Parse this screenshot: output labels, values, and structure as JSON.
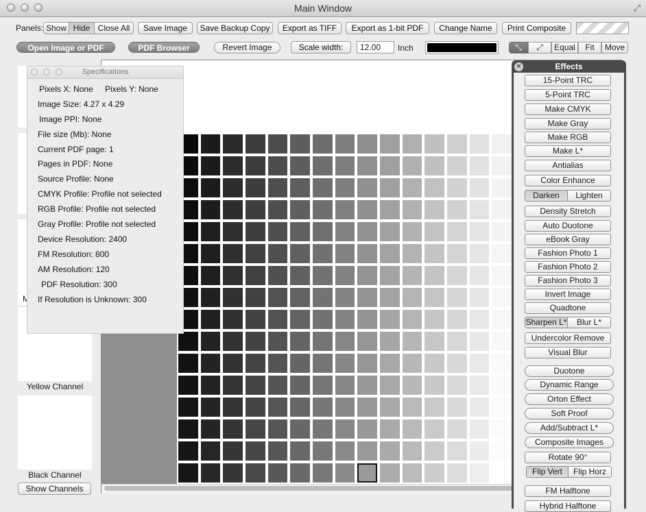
{
  "window": {
    "title": "Main Window"
  },
  "toolbar": {
    "panels_label": "Panels:",
    "panels_show": "Show",
    "panels_hide": "Hide",
    "panels_close_all": "Close All",
    "save_image": "Save Image",
    "save_backup_copy": "Save Backup Copy",
    "export_tiff": "Export as TIFF",
    "export_1bit_pdf": "Export as 1-bit PDF",
    "change_name": "Change Name",
    "print_composite": "Print Composite"
  },
  "toolbar2": {
    "open_image": "Open Image or PDF",
    "pdf_browser": "PDF Browser",
    "revert_image": "Revert Image",
    "scale_width_label": "Scale width:",
    "scale_value": "12.00",
    "unit": "Inch",
    "equal": "Equal",
    "fit": "Fit",
    "move": "Move"
  },
  "channels": {
    "partial_label": "M",
    "yellow": "Yellow Channel",
    "black": "Black Channel",
    "show_channels": "Show Channels"
  },
  "specs": {
    "title": "Specifications",
    "pixels_x": "Pixels X:  None",
    "pixels_y": "Pixels Y:  None",
    "image_size": "Image Size:  4.27     x 4.29",
    "image_ppi": "Image PPI:  None",
    "file_size": "File size (Mb):  None",
    "current_pdf_page": "Current PDF page:   1",
    "pages_in_pdf": "Pages in PDF:   None",
    "source_profile": "Source Profile:   None",
    "cmyk_profile": "CMYK Profile:   Profile not selected",
    "rgb_profile": "RGB Profile:   Profile not selected",
    "gray_profile": "Gray Profile:   Profile not selected",
    "device_resolution": "Device Resolution:   2400",
    "fm_resolution": "FM Resolution:   800",
    "am_resolution": "AM Resolution:   120",
    "pdf_resolution": "PDF Resolution:   300",
    "unknown_resolution": "If Resolution is Unknown:  300"
  },
  "effects": {
    "title": "Effects",
    "items": [
      "15-Point TRC",
      "5-Point TRC",
      "Make CMYK",
      "Make Gray",
      "Make RGB",
      "Make L*",
      "Antialias",
      "Color Enhance"
    ],
    "darken": "Darken",
    "lighten": "Lighten",
    "items2": [
      "Density Stretch",
      "Auto Duotone",
      "eBook Gray",
      "Fashion Photo 1",
      "Fashion Photo 2",
      "Fashion Photo 3",
      "Invert Image",
      "Quadtone"
    ],
    "sharpen": "Sharpen L*",
    "blur": "Blur L*",
    "items3": [
      "Undercolor Remove",
      "Visual Blur"
    ],
    "items4": [
      "Duotone",
      "Dynamic Range",
      "Orton Effect",
      "Soft Proof",
      "Add/Subtract L*",
      "Composite Images"
    ],
    "rotate": "Rotate 90°",
    "flip_vert": "Flip Vert",
    "flip_horz": "Flip Horz",
    "fm_halftone": "FM Halftone",
    "hybrid_halftone": "Hybrid Halftone"
  },
  "grid": {
    "selected_row": 15,
    "selected_col": 8
  },
  "colors": {
    "color_well": "#000000"
  }
}
